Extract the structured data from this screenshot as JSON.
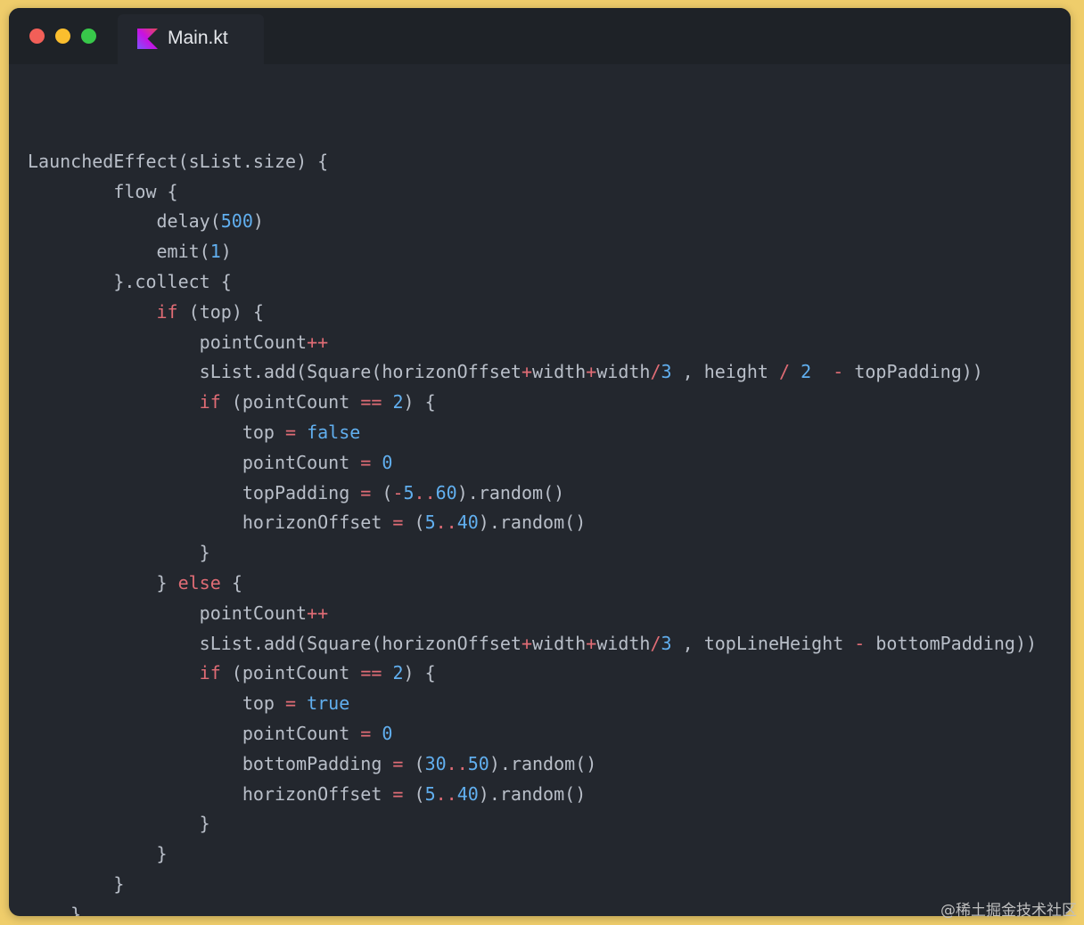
{
  "window": {
    "controls": [
      "close",
      "minimize",
      "maximize"
    ],
    "tab": {
      "label": "Main.kt",
      "icon": "kotlin-icon"
    }
  },
  "code": {
    "language": "kotlin",
    "lines": [
      "",
      "LaunchedEffect(sList.size) {",
      "        flow {",
      "            delay(500)",
      "            emit(1)",
      "        }.collect {",
      "            if (top) {",
      "                pointCount++",
      "                sList.add(Square(horizonOffset+width+width/3 , height / 2  - topPadding))",
      "                if (pointCount == 2) {",
      "                    top = false",
      "                    pointCount = 0",
      "                    topPadding = (-5..60).random()",
      "                    horizonOffset = (5..40).random()",
      "                }",
      "            } else {",
      "                pointCount++",
      "                sList.add(Square(horizonOffset+width+width/3 , topLineHeight - bottomPadding))",
      "                if (pointCount == 2) {",
      "                    top = true",
      "                    pointCount = 0",
      "                    bottomPadding = (30..50).random()",
      "                    horizonOffset = (5..40).random()",
      "                }",
      "            }",
      "        }",
      "    }"
    ]
  },
  "colors": {
    "background": "#efcd6b",
    "editor": "#23272e",
    "titlebar": "#1e2227",
    "text": "#b9bfc9",
    "keyword": "#e06c75",
    "number": "#61afef"
  },
  "watermark": "@稀土掘金技术社区"
}
